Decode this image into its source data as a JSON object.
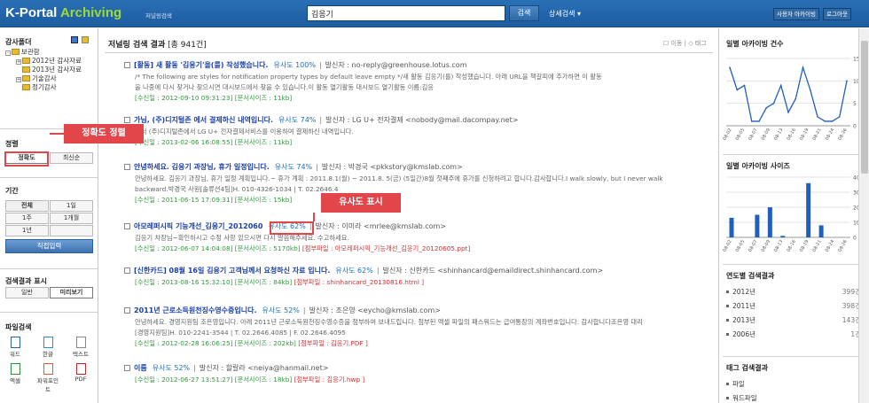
{
  "header": {
    "logo_main": "K-Portal",
    "logo_accent": "Archiving",
    "logo_sub": "저널링검색",
    "search_value": "김응기",
    "search_button": "검색",
    "advanced_search": "상세검색 ▾",
    "user_archive_button": "사용자 아카이빙",
    "logout_button": "로그아웃"
  },
  "left": {
    "folder_title": "감사폴더",
    "folders": [
      "보관함",
      "2012년 감사자료",
      "2013년 감사자료",
      "기술감사",
      "정기감사"
    ],
    "sort_title": "정렬",
    "sort_buttons": [
      "정확도",
      "최신순"
    ],
    "period_title": "기간",
    "period_buttons": [
      "전체",
      "1일",
      "1주",
      "1개월",
      "1년"
    ],
    "direct_input": "직접입력",
    "display_title": "검색결과 표시",
    "display_buttons": [
      "일반",
      "미리보기"
    ],
    "filetype_title": "파일검색",
    "filetypes": [
      "워드",
      "한글",
      "텍스트",
      "엑셀",
      "파워포인트",
      "PDF"
    ]
  },
  "main": {
    "title_prefix": "저널링 검색 결과",
    "title_count": "[총 941건]",
    "tools": "☐ 이동 | ◇ 태그",
    "results": [
      {
        "title": "[활동] 새 활동 '김응기'을(를) 작성했습니다.",
        "similarity": "유사도 100%",
        "sender": "발신자 : no-reply@greenhouse.lotus.com",
        "body": [
          "/* The following are styles for notification property types by default leave empty */새 활동 김응기(를) 작성했습니다. 아래 URL을 책갈피에 추가하면 이 활동",
          "을 나중에 다시 찾거나 찾으시면 대시보드에서 찾을 수 있습니다.이 활동 열기활동 대시보드 열기활동 이름:김응"
        ],
        "date": "[수신일 : 2012-09-10 09:31:23]",
        "size": "[문서사이즈 : 11kb]",
        "attachment": ""
      },
      {
        "title": "가님, (주)디지털존 에서 결제하신 내역입니다.",
        "similarity": "유사도 74%",
        "sender": "발신자 : LG U+ 전자결제 <nobody@mail.dacompay.net>",
        "body": [
          "에서 (주)디지털존에서 LG U+ 전자결제서비스를 이용하여 결제하신 내역입니다."
        ],
        "date": "[수신일 : 2013-02-06 16:08:55]",
        "size": "[문서사이즈 : 11kb]",
        "attachment": ""
      },
      {
        "title": "안녕하세요. 김응기 과장님, 휴가 일정입니다.",
        "similarity": "유사도 74%",
        "sender": "발신자 : 박경국 <pkkstory@kmslab.com>",
        "body": [
          "안녕하세요. 김응기 과장님, 휴가 일정 계획입니다.~ 휴가 계획 : 2011.8.1(월) ~ 2011.8. 5(금) (5일간)8월 첫째주에 휴가를 신청하려고 합니다.감사합니다.I walk slowly, but I never walk",
          "backward.박경국 사원[솔류션4팀]H. 010-4326-1034 | T. 02.2646.4"
        ],
        "date": "[수신일 : 2011-06-15 17:09:31]",
        "size": "[문서사이즈 : 15kb]",
        "attachment": ""
      },
      {
        "title": "아모레퍼시픽 기능개선_김응기_2012060",
        "similarity": "유사도 62%",
        "sender": "발신자 : 이미라 <mrlee@kmslab.com>",
        "body": [
          "김응기 차장님~확인하시고 수정 사항 있으시면 다시 말씀해주세요. 수고하세요."
        ],
        "date": "[수신일 : 2012-06-07 14:04:08]",
        "size": "[문서사이즈 : 5170kb]",
        "attachment": "[첨부파일 : 아모레퍼시픽_기능개선_김응기_20120605.ppt]"
      },
      {
        "title": "[신한카드] 08월 16일 김응기 고객님께서 요청하신 자료 입니다.",
        "similarity": "유사도 62%",
        "sender": "발신자 : 신한카드 <shinhancard@emaildirect.shinhancard.com>",
        "body": [],
        "date": "[수신일 : 2013-08-16 15:32:10]",
        "size": "[문서사이즈 : 84kb]",
        "attachment": "[첨부파일 : shinhancard_20130816.html ]"
      },
      {
        "title": "2011년 근로소득원천징수영수증입니다.",
        "similarity": "유사도 52%",
        "sender": "발신자 : 조은영 <eycho@kmslab.com>",
        "body": [
          "안녕하세요. 경영지원팀 조은영입니다. 아래 2011년 근로소득원천징수영수증을 첨부하여 보내드립니다. 첨부된 엑셀 파일의 패스워드는 급여통장의 계좌번호입니다. 감사합니다조은영 대리",
          "[경영지원팀]H. 010-2241-3544 | T. 02.2646.4085 | F. 02.2646.4095"
        ],
        "date": "[수신일 : 2012-02-28 16:06:25]",
        "size": "[문서사이즈 : 202kb]",
        "attachment": "[첨부파일 : 김응기.PDF ]"
      },
      {
        "title": "이름",
        "similarity": "유사도 52%",
        "sender": "발신자 : 할랄라 <neiya@hanmail.net>",
        "body": [],
        "date": "[수신일 : 2012-06-27 13:51:27]",
        "size": "[문서사이즈 : 18kb]",
        "attachment": "[첨부파일 : 김응기.hwp ]"
      }
    ]
  },
  "callouts": {
    "sort": "정확도 정렬",
    "similarity": "유사도 표시"
  },
  "right": {
    "daily_count_title": "일별 아카이빙 건수",
    "daily_size_title": "일별 아카이빙 사이즈",
    "yearly_title": "연도별 검색결과",
    "yearly": [
      {
        "label": "2012년",
        "count": "399건"
      },
      {
        "label": "2011년",
        "count": "398건"
      },
      {
        "label": "2013년",
        "count": "143건"
      },
      {
        "label": "2006년",
        "count": "1건"
      }
    ],
    "tag_title": "태그 검색결과",
    "tags": [
      "파일",
      "워드파일"
    ]
  },
  "chart_data": [
    {
      "type": "line",
      "title": "일별 아카이빙 건수",
      "categories": [
        "08-02",
        "08-05",
        "08-07",
        "08-09",
        "08-13",
        "08-16",
        "08-19",
        "08-21",
        "08-24",
        "08-26"
      ],
      "values": [
        13,
        8,
        9,
        1,
        1,
        4,
        5,
        9,
        3,
        6,
        13,
        8,
        2,
        1,
        1,
        2,
        10
      ],
      "ylim": [
        0,
        15
      ],
      "yticks": [
        0,
        5,
        10,
        15
      ],
      "color": "#1f5fbd"
    },
    {
      "type": "bar",
      "title": "일별 아카이빙 사이즈",
      "categories": [
        "08-02",
        "08-05",
        "08-07",
        "08-09",
        "08-13",
        "08-16",
        "08-19",
        "08-21",
        "08-24",
        "08-26"
      ],
      "values": [
        13,
        0,
        15,
        20,
        1,
        0,
        36,
        8,
        0,
        0
      ],
      "ylim": [
        0,
        40
      ],
      "yticks": [
        0,
        10,
        20,
        30,
        40
      ],
      "color": "#1f5fbd"
    }
  ]
}
